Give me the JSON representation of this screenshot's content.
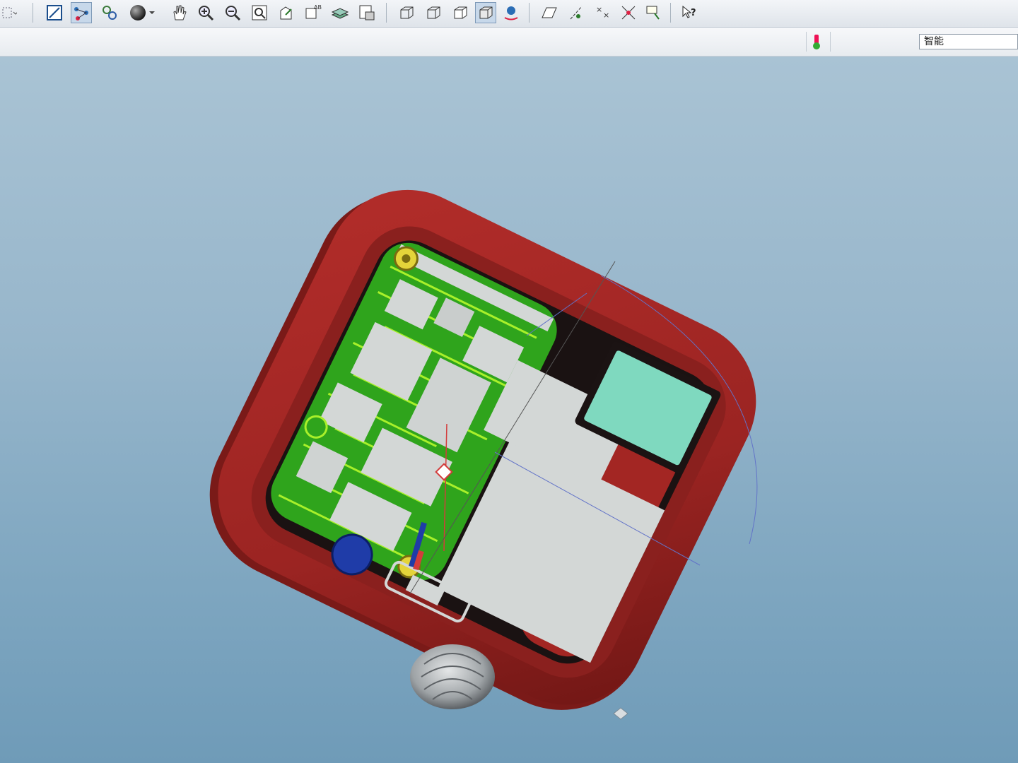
{
  "app": {
    "toolbar": {
      "buttons": [
        {
          "name": "sketch-view-button",
          "icon": "sketch-window-icon"
        },
        {
          "name": "datum-display-button",
          "icon": "datum-axes-icon",
          "active": true
        },
        {
          "name": "regenerate-button",
          "icon": "regenerate-icon"
        },
        {
          "name": "appearance-button",
          "icon": "sphere-appearance-icon"
        },
        {
          "name": "pan-button",
          "icon": "hand-pan-icon"
        },
        {
          "name": "zoom-in-button",
          "icon": "zoom-in-icon"
        },
        {
          "name": "zoom-out-button",
          "icon": "zoom-out-icon"
        },
        {
          "name": "refit-button",
          "icon": "refit-icon"
        },
        {
          "name": "reorient-button",
          "icon": "reorient-icon"
        },
        {
          "name": "saved-views-button",
          "icon": "saved-views-icon"
        },
        {
          "name": "layers-button",
          "icon": "layers-icon"
        },
        {
          "name": "view-manager-button",
          "icon": "view-manager-icon"
        },
        {
          "name": "wireframe-button",
          "icon": "wireframe-cube-icon"
        },
        {
          "name": "hidden-line-button",
          "icon": "hidden-line-cube-icon"
        },
        {
          "name": "no-hidden-button",
          "icon": "no-hidden-cube-icon"
        },
        {
          "name": "shading-button",
          "icon": "shaded-cube-icon",
          "active": true
        },
        {
          "name": "spin-center-button",
          "icon": "spin-center-icon"
        },
        {
          "name": "datum-planes-button",
          "icon": "datum-plane-icon"
        },
        {
          "name": "datum-axes-button",
          "icon": "datum-axis-icon"
        },
        {
          "name": "datum-points-button",
          "icon": "datum-point-icon"
        },
        {
          "name": "csys-button",
          "icon": "coordinate-system-icon"
        },
        {
          "name": "annotations-button",
          "icon": "annotation-icon"
        },
        {
          "name": "context-help-button",
          "icon": "context-help-icon"
        }
      ]
    },
    "statusbar": {
      "status_light": "green-status-light-icon",
      "filter": {
        "value": "智能"
      }
    },
    "colors": {
      "housing": "#9b2422",
      "pcb": "#2fa41c",
      "pcb_trace": "#a8f02a",
      "component": "#d3d7d6",
      "battery_connector": "#7fd9bf",
      "crown": "#9ea3a6",
      "datum_axis": "#d33c3c",
      "datum_plane": "#6273c8"
    }
  }
}
